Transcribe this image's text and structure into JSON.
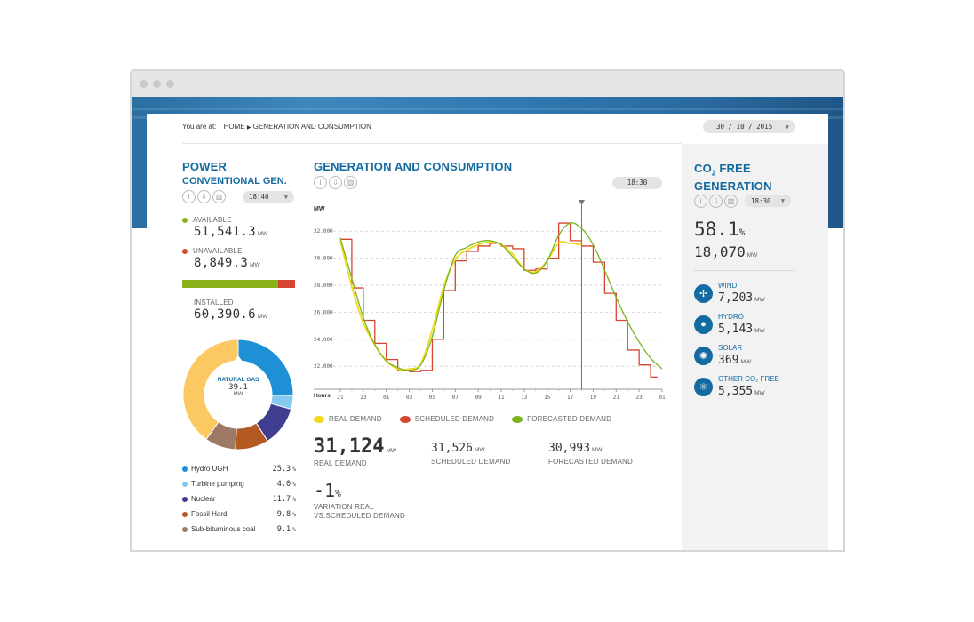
{
  "breadcrumb": {
    "label": "You are at:",
    "home": "HOME",
    "current": "GENERATION AND CONSUMPTION"
  },
  "date_selector": {
    "value": "30 / 10 / 2015"
  },
  "power": {
    "title": "POWER",
    "subtitle": "CONVENTIONAL GEN.",
    "time": "18:40",
    "available": {
      "label": "AVAILABLE",
      "value": "51,541.3",
      "unit": "MW",
      "color": "#8cb21b"
    },
    "unavailable": {
      "label": "UNAVAILABLE",
      "value": "8,849.3",
      "unit": "MW",
      "color": "#d64530"
    },
    "available_share": 0.853,
    "installed": {
      "label": "INSTALLED",
      "value": "60,390.6",
      "unit": "MW"
    },
    "donut": {
      "center_label": "NATURAL GAS",
      "center_value": "39.1",
      "center_unit": "MW",
      "segments": [
        {
          "name": "Hydro UGH",
          "value": 25.3,
          "color": "#1f8fd6"
        },
        {
          "name": "Turbine pumping",
          "value": 4.0,
          "color": "#86c9ee"
        },
        {
          "name": "Nuclear",
          "value": 11.7,
          "color": "#3f3d8f"
        },
        {
          "name": "Fossil Hard",
          "value": 9.8,
          "color": "#b35a23"
        },
        {
          "name": "Sub-bituminous coal",
          "value": 9.1,
          "color": "#9c7a66"
        },
        {
          "name": "Natural gas",
          "value": 40.1,
          "color": "#fcc862"
        }
      ]
    },
    "legend": [
      {
        "name": "Hydro UGH",
        "pct": "25.3",
        "color": "#1f8fd6"
      },
      {
        "name": "Turbine pumping",
        "pct": "4.0",
        "color": "#86c9ee"
      },
      {
        "name": "Nuclear",
        "pct": "11.7",
        "color": "#3f3d8f"
      },
      {
        "name": "Fossil Hard",
        "pct": "9.8",
        "color": "#b35a23"
      },
      {
        "name": "Sub-bituminous coal",
        "pct": "9.1",
        "color": "#9c7a66"
      }
    ],
    "pct_unit": "%"
  },
  "generation": {
    "title": "GENERATION AND CONSUMPTION",
    "time": "18:30",
    "legend": {
      "real": {
        "label": "REAL DEMAND",
        "color": "#f2d91a"
      },
      "scheduled": {
        "label": "SCHEDULED DEMAND",
        "color": "#d64530"
      },
      "forecasted": {
        "label": "FORECASTED DEMAND",
        "color": "#7ab51d"
      }
    },
    "real_value": "31,124",
    "real_label": "REAL DEMAND",
    "scheduled_value": "31,526",
    "scheduled_label": "SCHEDULED DEMAND",
    "forecasted_value": "30,993",
    "forecasted_label": "FORECASTED DEMAND",
    "unit": "MW",
    "variation_value": "-1",
    "variation_unit": "%",
    "variation_label_1": "VARIATION REAL",
    "variation_label_2": "VS.SCHEDULED DEMAND"
  },
  "chart_data": {
    "type": "line",
    "ylabel": "MW",
    "xlabel": "Hours",
    "ylim": [
      20500,
      33000
    ],
    "yticks": [
      "32.000",
      "30.000",
      "28.000",
      "26.000",
      "24.000",
      "22.000"
    ],
    "ytick_values": [
      32000,
      30000,
      28000,
      26000,
      24000,
      22000
    ],
    "categories": [
      "21",
      "23",
      "01",
      "03",
      "05",
      "07",
      "09",
      "11",
      "13",
      "15",
      "17",
      "19",
      "21",
      "23",
      "01"
    ],
    "marker_x": 21,
    "grid": true,
    "series": [
      {
        "name": "SCHEDULED DEMAND",
        "color": "#d64530",
        "step": true,
        "x": [
          0,
          1,
          2,
          3,
          4,
          5,
          6,
          7,
          8,
          9,
          10,
          11,
          12,
          13,
          14,
          15,
          16,
          17,
          18,
          19,
          20,
          21,
          22,
          23,
          24,
          25,
          26,
          27
        ],
        "values": [
          31400,
          27800,
          25400,
          23700,
          22500,
          21700,
          21600,
          21700,
          24000,
          27600,
          29800,
          30500,
          30900,
          31100,
          30900,
          30700,
          29100,
          29200,
          30000,
          32600,
          31300,
          30900,
          29700,
          27400,
          25400,
          23200,
          22100,
          21200
        ]
      },
      {
        "name": "REAL DEMAND",
        "color": "#f2d91a",
        "x": [
          0,
          1,
          2,
          3,
          4,
          5,
          6,
          7,
          8,
          9,
          10,
          11,
          12,
          13,
          14,
          15,
          16,
          17,
          18,
          19,
          20,
          21
        ],
        "values": [
          31300,
          27900,
          25200,
          23600,
          22400,
          21800,
          21800,
          22200,
          24700,
          27900,
          29900,
          30600,
          31000,
          31200,
          31000,
          30300,
          29200,
          29000,
          29800,
          31124,
          31100,
          31000
        ]
      },
      {
        "name": "FORECASTED DEMAND",
        "color": "#7ab51d",
        "x": [
          0,
          1,
          2,
          3,
          4,
          5,
          6,
          7,
          8,
          9,
          10,
          11,
          12,
          13,
          14,
          15,
          16,
          17,
          18,
          19,
          20,
          21,
          22,
          23,
          24,
          25,
          26,
          27,
          28
        ],
        "values": [
          31500,
          28500,
          25600,
          23600,
          22400,
          21900,
          21700,
          22100,
          24200,
          27600,
          30200,
          30800,
          31200,
          31300,
          31000,
          30100,
          29200,
          28900,
          29800,
          31700,
          32600,
          32200,
          31000,
          29100,
          27100,
          25300,
          23800,
          22600,
          21800
        ]
      }
    ]
  },
  "co2": {
    "title_prefix": "CO",
    "title_sub": "2",
    "title_suffix": " FREE",
    "title_line2": "GENERATION",
    "time": "18:30",
    "percent": "58.1",
    "percent_unit": "%",
    "mw": "18,070",
    "mw_unit": "MW",
    "items": [
      {
        "label": "WIND",
        "value": "7,203",
        "unit": "MW",
        "icon": "wind-turbine-icon",
        "glyph": "✢"
      },
      {
        "label": "HYDRO",
        "value": "5,143",
        "unit": "MW",
        "icon": "water-drop-icon",
        "glyph": "●"
      },
      {
        "label": "SOLAR",
        "value": "369",
        "unit": "MW",
        "icon": "sun-icon",
        "glyph": "✺"
      },
      {
        "label": "OTHER CO₂ FREE",
        "value": "5,355",
        "unit": "MW",
        "icon": "atom-icon",
        "glyph": "⚛"
      }
    ]
  }
}
